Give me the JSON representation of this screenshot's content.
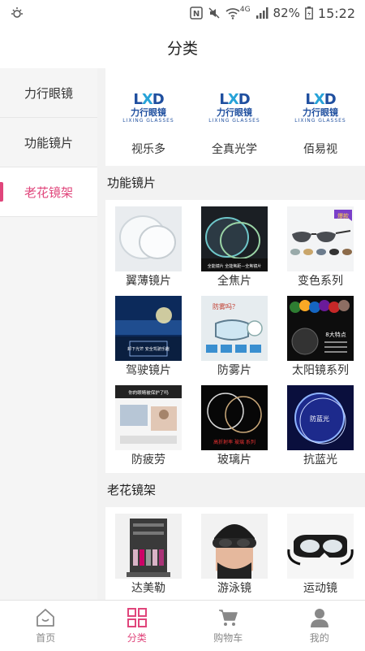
{
  "status_bar": {
    "battery": "82%",
    "time": "15:22",
    "network": "4G",
    "icons": [
      "loader-icon",
      "nfc-icon",
      "mute-icon",
      "wifi-icon",
      "signal-icon",
      "battery-icon"
    ]
  },
  "header": {
    "title": "分类"
  },
  "sidebar": {
    "items": [
      {
        "label": "力行眼镜",
        "active": false
      },
      {
        "label": "功能镜片",
        "active": false
      },
      {
        "label": "老花镜架",
        "active": true
      }
    ]
  },
  "brands": {
    "logo": {
      "word": "LXD",
      "cn": "力行眼镜",
      "en": "LIXING GLASSES"
    },
    "items": [
      {
        "label": "视乐多"
      },
      {
        "label": "全真光学"
      },
      {
        "label": "佰易视"
      }
    ]
  },
  "functional": {
    "title": "功能镜片",
    "items": [
      {
        "label": "翼薄镜片",
        "thumb": "thin-lens-image"
      },
      {
        "label": "全焦片",
        "thumb": "progressive-lens-image",
        "banner": "全能镜片 全能焦距—全焦镜片"
      },
      {
        "label": "变色系列",
        "thumb": "photochromic-sunglasses-image",
        "badge": "爆款"
      },
      {
        "label": "驾驶镜片",
        "thumb": "driving-lens-image",
        "banner": "卸下光芒 安全驾驶乐趣"
      },
      {
        "label": "防雾片",
        "thumb": "anti-fog-lens-image",
        "banner": "防雾吗？"
      },
      {
        "label": "太阳镜系列",
        "thumb": "sunglass-lens-image",
        "banner": "8大特点"
      },
      {
        "label": "防疲劳",
        "thumb": "anti-fatigue-lens-image",
        "banner": "你的眼睛被保护了吗"
      },
      {
        "label": "玻璃片",
        "thumb": "glass-lens-image",
        "banner": "高折射率 玻璃 系列"
      },
      {
        "label": "抗蓝光",
        "thumb": "blue-light-lens-image",
        "banner": "防蓝光"
      }
    ]
  },
  "reading": {
    "title": "老花镜架",
    "items": [
      {
        "label": "达美勒",
        "thumb": "reading-glasses-display-image"
      },
      {
        "label": "游泳镜",
        "thumb": "swim-goggles-image"
      },
      {
        "label": "运动镜",
        "thumb": "sports-goggles-image"
      }
    ]
  },
  "bottom_nav": {
    "items": [
      {
        "label": "首页",
        "icon": "home-icon"
      },
      {
        "label": "分类",
        "icon": "grid-icon",
        "active": true
      },
      {
        "label": "购物车",
        "icon": "cart-icon"
      },
      {
        "label": "我的",
        "icon": "person-icon"
      }
    ]
  },
  "colors": {
    "accent": "#e0457b",
    "brand_blue": "#1f4f9f",
    "brand_cyan": "#27a3d8"
  }
}
